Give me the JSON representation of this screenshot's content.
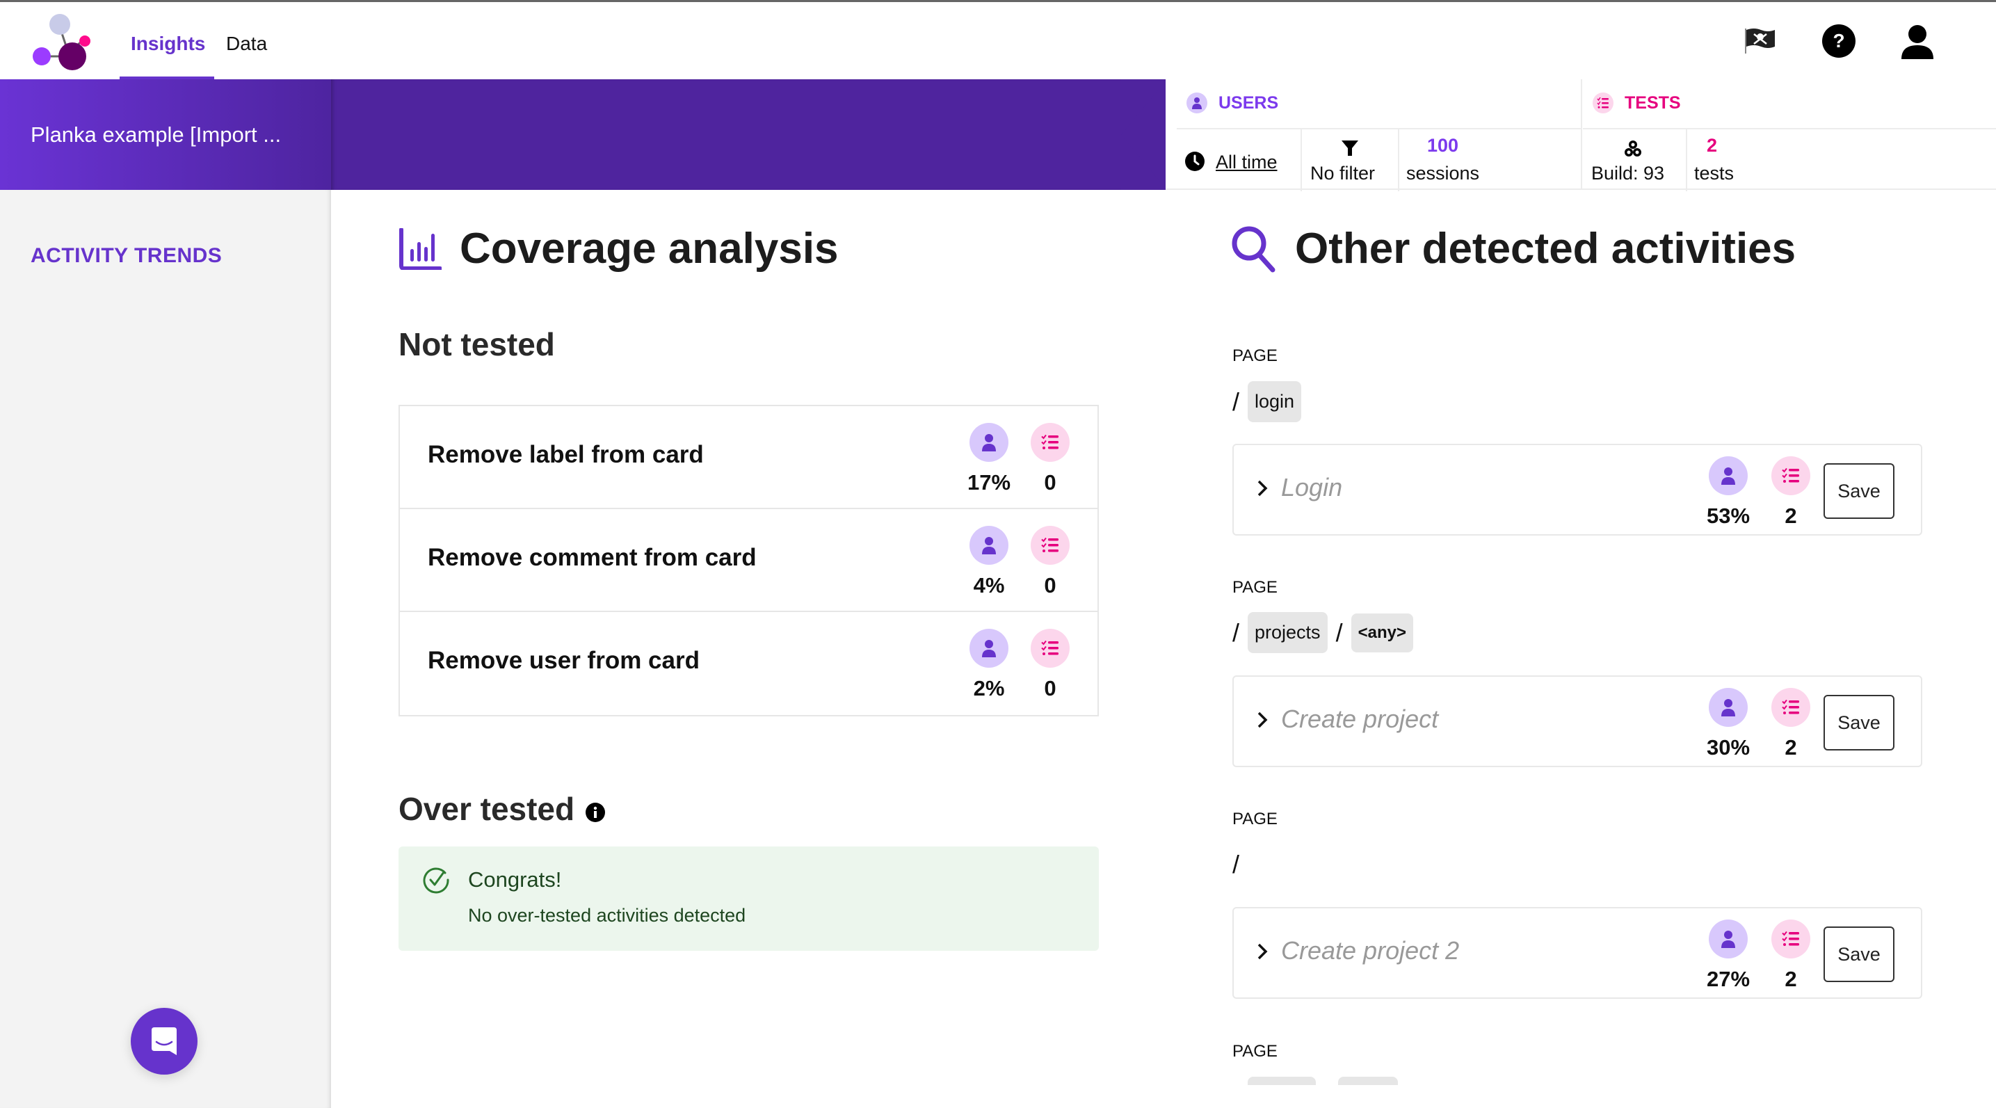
{
  "nav": {
    "tabs": [
      {
        "label": "Insights",
        "active": true
      },
      {
        "label": "Data",
        "active": false
      }
    ],
    "icons": [
      "pirate-flag-icon",
      "help-icon",
      "account-icon"
    ]
  },
  "project": {
    "title": "Planka example [Import ..."
  },
  "stats": {
    "users": {
      "label": "USERS",
      "time_range": "All time",
      "filter": "No filter",
      "sessions_count": "100",
      "sessions_label": "sessions",
      "color": "#7c3aed"
    },
    "tests": {
      "label": "TESTS",
      "build": "Build: 93",
      "tests_count": "2",
      "tests_label": "tests",
      "color": "#e6007e"
    }
  },
  "sidebar": {
    "items": [
      {
        "label": "ACTIVITY TRENDS"
      }
    ]
  },
  "coverage": {
    "title": "Coverage analysis",
    "not_tested": {
      "title": "Not tested",
      "rows": [
        {
          "name": "Remove label from card",
          "users": "17%",
          "tests": "0"
        },
        {
          "name": "Remove comment from card",
          "users": "4%",
          "tests": "0"
        },
        {
          "name": "Remove user from card",
          "users": "2%",
          "tests": "0"
        }
      ]
    },
    "over_tested": {
      "title": "Over tested",
      "congrats_title": "Congrats!",
      "congrats_text": "No over-tested activities detected"
    }
  },
  "other": {
    "title": "Other detected activities",
    "page_label": "PAGE",
    "save_label": "Save",
    "groups": [
      {
        "path": [
          "login"
        ],
        "activity": {
          "name": "Login",
          "users": "53%",
          "tests": "2"
        }
      },
      {
        "path": [
          "projects",
          "<any>"
        ],
        "activity": {
          "name": "Create project",
          "users": "30%",
          "tests": "2"
        }
      },
      {
        "path": [],
        "activity": {
          "name": "Create project 2",
          "users": "27%",
          "tests": "2"
        }
      }
    ]
  },
  "colors": {
    "brand": "#6633cc",
    "band": "#4f249e",
    "user_circle": "#d8c8fc",
    "test_circle": "#fcd6ec",
    "test_pink": "#e6007e",
    "success_bg": "#ecf6ed"
  }
}
